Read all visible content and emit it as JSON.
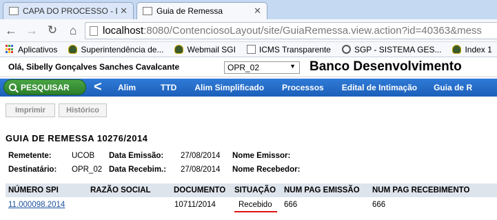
{
  "browser": {
    "tabs": [
      {
        "label": "CAPA DO PROCESSO - DO",
        "active": false
      },
      {
        "label": "Guia de Remessa",
        "active": true
      }
    ],
    "url_host": "localhost",
    "url_path": ":8080/ContenciosoLayout/site/GuiaRemessa.view.action?id=40363&mess",
    "bookmarks": [
      {
        "label": "Aplicativos",
        "icon": "apps-icon"
      },
      {
        "label": "Superintendência de...",
        "icon": "owl-icon"
      },
      {
        "label": "Webmail SGI",
        "icon": "owl-icon"
      },
      {
        "label": "ICMS Transparente",
        "icon": "page-icon"
      },
      {
        "label": "SGP - SISTEMA GES...",
        "icon": "gear-icon"
      },
      {
        "label": "Index 1",
        "icon": "owl-icon"
      }
    ]
  },
  "header": {
    "greeting": "Olá, Sibelly Gonçalves Sanches Cavalcante",
    "profile_selected": "OPR_02",
    "bank_name": "Banco Desenvolvimento"
  },
  "nav": {
    "search_label": "PESQUISAR",
    "prev_glyph": "<",
    "items": [
      "Alim",
      "TTD",
      "Alim Simplificado",
      "Processos",
      "Edital de Intimação",
      "Guia de R"
    ]
  },
  "actions": {
    "print_label": "Imprimir",
    "history_label": "Histórico"
  },
  "guide": {
    "title": "GUIA DE REMESSA 10276/2014",
    "labels": {
      "sender": "Remetente:",
      "emission_date": "Data Emissão:",
      "emitter_name": "Nome Emissor:",
      "recipient": "Destinatário:",
      "receipt_date": "Data Recebim.:",
      "receiver_name": "Nome Recebedor:"
    },
    "values": {
      "sender": "UCOB",
      "emission_date": "27/08/2014",
      "emitter_name": "",
      "recipient": "OPR_02",
      "receipt_date": "27/08/2014",
      "receiver_name": ""
    }
  },
  "table": {
    "columns": [
      "NÚMERO SPI",
      "RAZÃO SOCIAL",
      "DOCUMENTO",
      "SITUAÇÃO",
      "NUM PAG EMISSÃO",
      "NUM PAG RECEBIMENTO"
    ],
    "rows": [
      {
        "numero_spi": "11.000098.2014",
        "razao_social": "",
        "documento": "10711/2014",
        "situacao": "Recebido",
        "num_pag_emissao": "666",
        "num_pag_recebimento": "666"
      }
    ]
  },
  "colors": {
    "nav_blue": "#1c5fb8",
    "search_green": "#2b7d2a",
    "link_blue": "#1a4f9c",
    "status_underline": "#e01414",
    "table_header_bg": "#dee4ec"
  }
}
